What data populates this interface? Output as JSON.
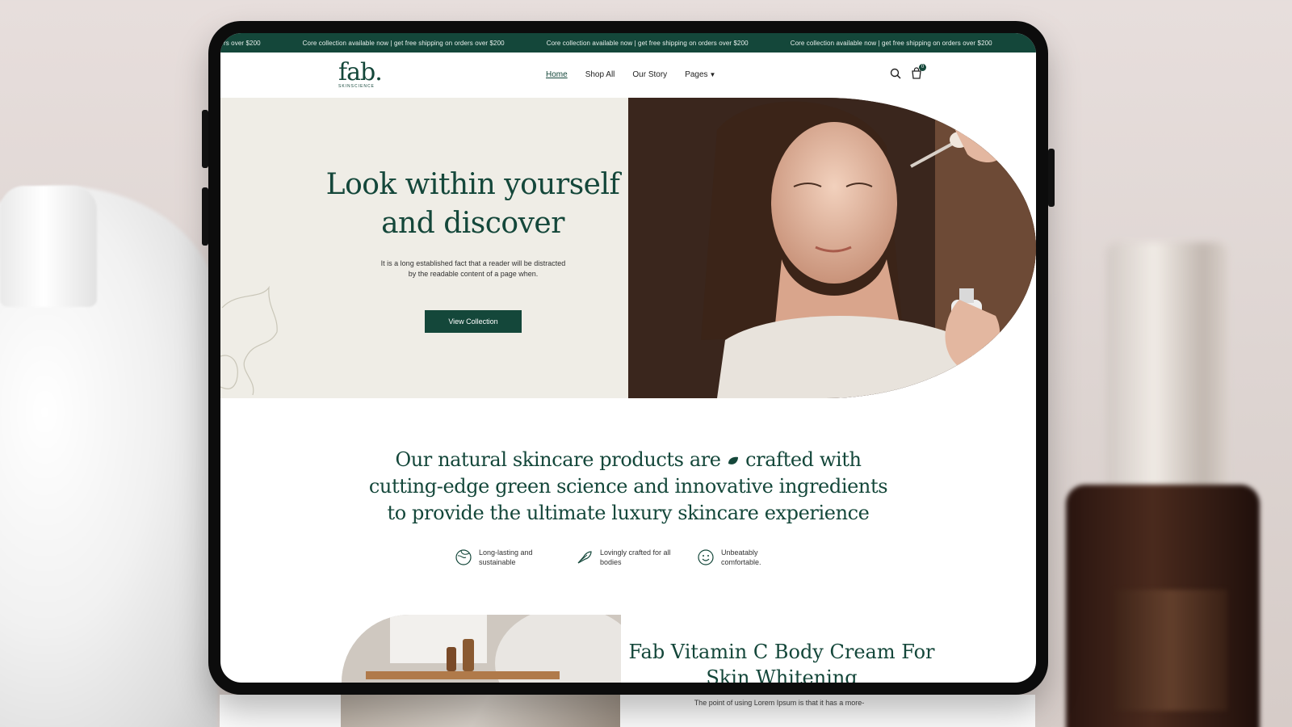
{
  "announcement": {
    "text": "Core collection available now | get free shipping on orders over $200",
    "lead_fragment": "rs over $200"
  },
  "brand": {
    "logo": "fab.",
    "subtitle": "SKINSCIENCE"
  },
  "nav": {
    "items": [
      {
        "label": "Home",
        "active": true
      },
      {
        "label": "Shop All"
      },
      {
        "label": "Our Story"
      },
      {
        "label": "Pages"
      }
    ],
    "cart_count": "0",
    "icons": [
      "search-icon",
      "cart-icon"
    ]
  },
  "hero": {
    "title_line1": "Look within yourself",
    "title_line2": "and discover",
    "text": "It is a long established fact that a reader will be distracted by the readable content of a page when.",
    "button": "View Collection"
  },
  "statement": {
    "part1": "Our natural skincare products are",
    "part2": "crafted with",
    "line2": "cutting-edge green science and innovative ingredients",
    "line3": "to provide the ultimate luxury skincare experience"
  },
  "features": [
    {
      "icon": "globe-leaf-icon",
      "text": "Long-lasting and sustainable"
    },
    {
      "icon": "hand-leaf-icon",
      "text": "Lovingly crafted for all bodies"
    },
    {
      "icon": "smile-icon",
      "text": "Unbeatably comfortable."
    }
  ],
  "product": {
    "title_line1": "Fab Vitamin C Body Cream For",
    "title_line2": "Skin Whitening",
    "text": "The point of using Lorem Ipsum is that it has a more-"
  },
  "colors": {
    "brand_green": "#14473a",
    "hero_bg": "#efede6"
  }
}
